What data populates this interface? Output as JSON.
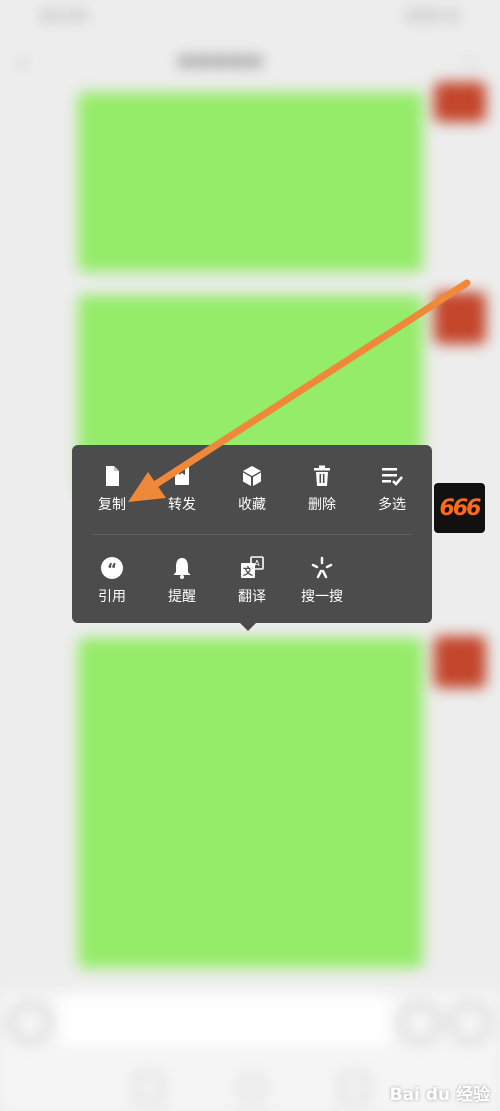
{
  "menu": {
    "row1": [
      {
        "label": "复制",
        "icon": "document-icon"
      },
      {
        "label": "转发",
        "icon": "forward-icon"
      },
      {
        "label": "收藏",
        "icon": "cube-icon"
      },
      {
        "label": "删除",
        "icon": "trash-icon"
      },
      {
        "label": "多选",
        "icon": "multiselect-icon"
      }
    ],
    "row2": [
      {
        "label": "引用",
        "icon": "quote-icon"
      },
      {
        "label": "提醒",
        "icon": "bell-icon"
      },
      {
        "label": "翻译",
        "icon": "translate-icon"
      },
      {
        "label": "搜一搜",
        "icon": "search-star-icon"
      }
    ]
  },
  "overlay_avatar": {
    "text": "666"
  },
  "watermark": "Bai du 经验",
  "colors": {
    "bubble": "#95ec69",
    "menu_background": "#4c4c4c",
    "annotation_arrow": "#f0883a",
    "app_background": "#ededed"
  }
}
